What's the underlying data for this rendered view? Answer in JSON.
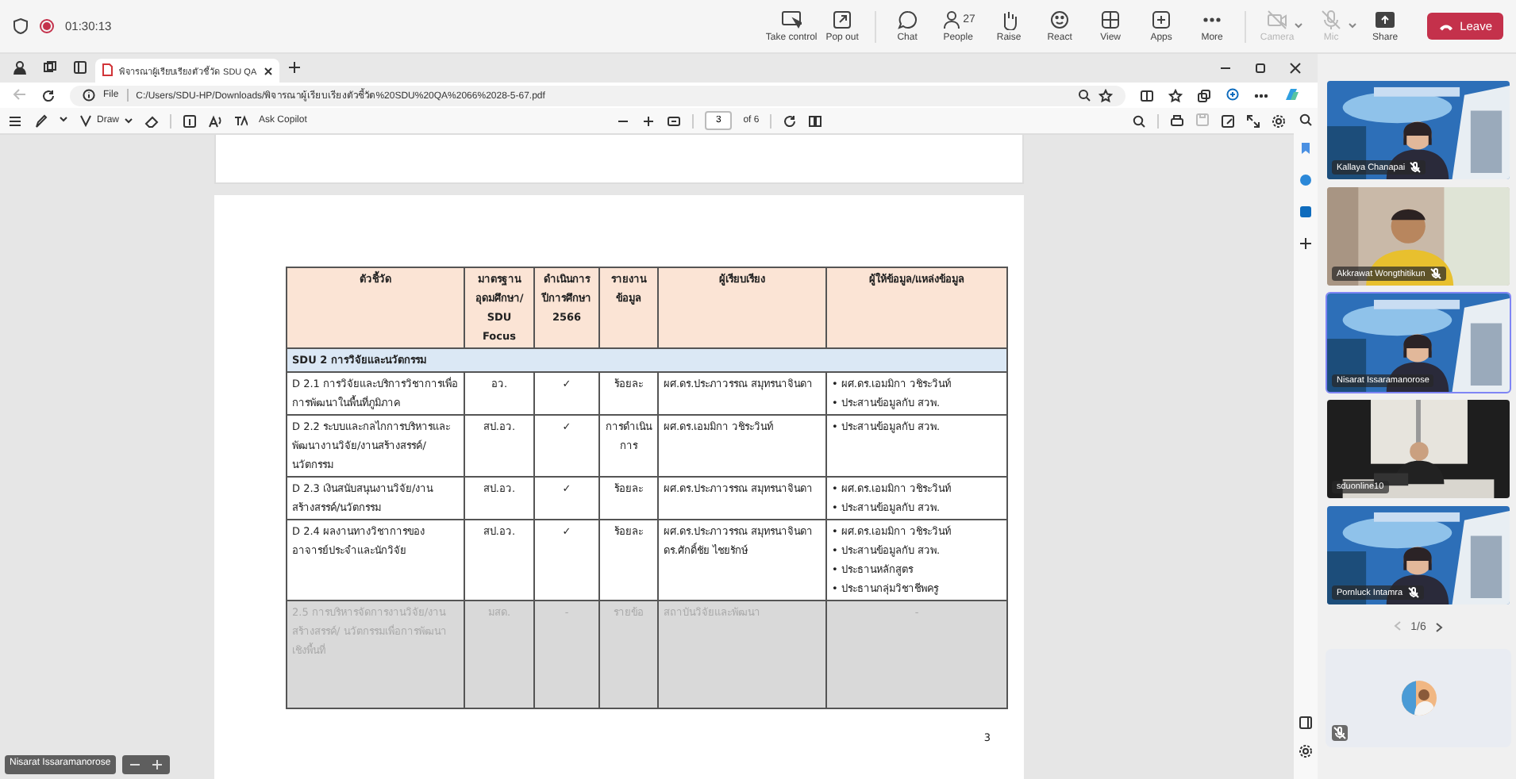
{
  "meeting": {
    "timer": "01:30:13",
    "recording": true,
    "actions": [
      {
        "label": "Take control",
        "disabled": false
      },
      {
        "label": "Pop out",
        "disabled": false
      },
      {
        "label": "Chat",
        "disabled": false
      },
      {
        "label": "People",
        "count": "27",
        "disabled": false
      },
      {
        "label": "Raise",
        "disabled": false
      },
      {
        "label": "React",
        "disabled": false
      },
      {
        "label": "View",
        "disabled": false
      },
      {
        "label": "Apps",
        "disabled": false
      },
      {
        "label": "More",
        "disabled": false
      },
      {
        "label": "Camera",
        "disabled": true
      },
      {
        "label": "Mic",
        "disabled": true
      },
      {
        "label": "Share",
        "disabled": false
      }
    ],
    "leave": "Leave"
  },
  "browser": {
    "tab": {
      "title": "พิจารณาผู้เรียบเรียงตัวชี้วัด SDU QA"
    },
    "address": {
      "scheme": "File",
      "url": "C:/Users/SDU-HP/Downloads/พิจารณาผู้เรียบเรียงตัวชี้วัด%20SDU%20QA%2066%2028-5-67.pdf"
    },
    "pdf_toolbar": {
      "draw": "Draw",
      "copilot": "Ask Copilot",
      "page": "3",
      "page_count": "of 6"
    }
  },
  "document": {
    "columns": [
      "ตัวชี้วัด",
      "มาตรฐาน อุดมศึกษา/ SDU Focus",
      "ดำเนินการ ปีการศึกษา 2566",
      "รายงาน ข้อมูล",
      "ผู้เรียบเรียง",
      "ผู้ให้ข้อมูล/แหล่งข้อมูล"
    ],
    "section": "SDU 2 การวิจัยและนวัตกรรม",
    "rows": [
      {
        "indicator": "D 2.1 การวิจัยและบริการวิชาการเพื่อการพัฒนาในพื้นที่ภูมิภาค",
        "standard": "อว.",
        "done": "✓",
        "unit": "ร้อยละ",
        "editors": [
          "ผศ.ดร.ประภาวรรณ สมุทรนาจินดา"
        ],
        "providers": [
          "• ผศ.ดร.เอมมิกา วชิระวินท์",
          "• ประสานข้อมูลกับ สวพ."
        ],
        "disabled": false
      },
      {
        "indicator": "D 2.2 ระบบและกลไกการบริหารและพัฒนางานวิจัย/งานสร้างสรรค์/นวัตกรรม",
        "standard": "สป.อว.",
        "done": "✓",
        "unit": "การดำเนินการ",
        "editors": [
          "ผศ.ดร.เอมมิกา วชิระวินท์"
        ],
        "providers": [
          "• ประสานข้อมูลกับ สวพ."
        ],
        "disabled": false
      },
      {
        "indicator": "D 2.3 เงินสนับสนุนงานวิจัย/งานสร้างสรรค์/นวัตกรรม",
        "standard": "สป.อว.",
        "done": "✓",
        "unit": "ร้อยละ",
        "editors": [
          "ผศ.ดร.ประภาวรรณ สมุทรนาจินดา"
        ],
        "providers": [
          "• ผศ.ดร.เอมมิกา วชิระวินท์",
          "• ประสานข้อมูลกับ สวพ."
        ],
        "disabled": false
      },
      {
        "indicator": "D 2.4 ผลงานทางวิชาการของอาจารย์ประจำและนักวิจัย",
        "standard": "สป.อว.",
        "done": "✓",
        "unit": "ร้อยละ",
        "editors": [
          "ผศ.ดร.ประภาวรรณ สมุทรนาจินดา",
          "ดร.ศักดิ์ชัย ไชยรักษ์"
        ],
        "providers": [
          "• ผศ.ดร.เอมมิกา วชิระวินท์",
          "• ประสานข้อมูลกับ สวพ.",
          "• ประธานหลักสูตร",
          "• ประธานกลุ่มวิชาชีพครู"
        ],
        "disabled": false
      },
      {
        "indicator": "2.5 การบริหารจัดการงานวิจัย/งานสร้างสรรค์/ นวัตกรรมเพื่อการพัฒนาเชิงพื้นที่",
        "standard": "มสด.",
        "done": "-",
        "unit": "รายข้อ",
        "editors": [
          "สถาบันวิจัยและพัฒนา"
        ],
        "providers": [
          "-"
        ],
        "disabled": true
      }
    ],
    "page_number": "3"
  },
  "presenter_label": "Nisarat Issaramanorose",
  "participants": [
    {
      "name": "Kallaya Chanapai",
      "muted": true,
      "selected": false
    },
    {
      "name": "Akkrawat Wongthitikun",
      "muted": true,
      "selected": false
    },
    {
      "name": "Nisarat Issaramanorose",
      "muted": false,
      "selected": true
    },
    {
      "name": "sduonline10",
      "muted": false,
      "selected": false
    },
    {
      "name": "Pornluck Intamra",
      "muted": true,
      "selected": false
    }
  ],
  "pager": "1/6",
  "self": {
    "muted": true
  }
}
